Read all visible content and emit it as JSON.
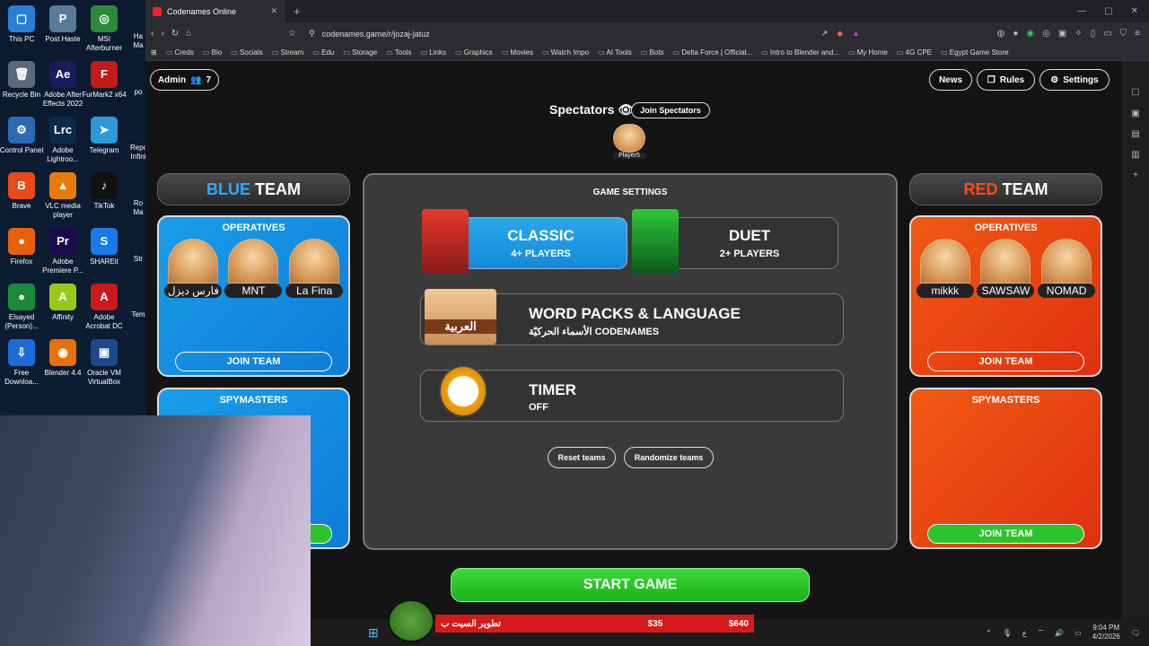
{
  "desktop": {
    "icons": [
      {
        "label": "This PC",
        "col": 0,
        "row": 0,
        "color": "#2a7fd4",
        "glyph": "▢"
      },
      {
        "label": "Post Haste",
        "col": 1,
        "row": 0,
        "color": "#5a7a9a",
        "glyph": "P"
      },
      {
        "label": "MSI Afterburner",
        "col": 2,
        "row": 0,
        "color": "#2a8a3a",
        "glyph": "◎"
      },
      {
        "label": "Recycle Bin",
        "col": 0,
        "row": 1,
        "color": "#5a6a7a",
        "glyph": "🗑"
      },
      {
        "label": "Adobe After Effects 2022",
        "col": 1,
        "row": 1,
        "color": "#1a1a5a",
        "glyph": "Ae"
      },
      {
        "label": "FurMark2 x64",
        "col": 2,
        "row": 1,
        "color": "#c41a1a",
        "glyph": "F"
      },
      {
        "label": "Control Panel",
        "col": 0,
        "row": 2,
        "color": "#2a6ab4",
        "glyph": "⚙"
      },
      {
        "label": "Adobe Lightroo...",
        "col": 1,
        "row": 2,
        "color": "#0a2a4a",
        "glyph": "Lrc"
      },
      {
        "label": "Telegram",
        "col": 2,
        "row": 2,
        "color": "#2a9ad8",
        "glyph": "➤"
      },
      {
        "label": "Brave",
        "col": 0,
        "row": 3,
        "color": "#e84a1a",
        "glyph": "B"
      },
      {
        "label": "VLC media player",
        "col": 1,
        "row": 3,
        "color": "#e87a0a",
        "glyph": "▲"
      },
      {
        "label": "TikTok",
        "col": 2,
        "row": 3,
        "color": "#111",
        "glyph": "♪"
      },
      {
        "label": "Firefox",
        "col": 0,
        "row": 4,
        "color": "#e8600a",
        "glyph": "●"
      },
      {
        "label": "Adobe Premiere P...",
        "col": 1,
        "row": 4,
        "color": "#1a0a4a",
        "glyph": "Pr"
      },
      {
        "label": "SHAREit",
        "col": 2,
        "row": 4,
        "color": "#1a7ae8",
        "glyph": "S"
      },
      {
        "label": "Elsayed (Person)...",
        "col": 0,
        "row": 5,
        "color": "#1a8a3a",
        "glyph": "●"
      },
      {
        "label": "Affinity",
        "col": 1,
        "row": 5,
        "color": "#9ac81a",
        "glyph": "A"
      },
      {
        "label": "Adobe Acrobat DC",
        "col": 2,
        "row": 5,
        "color": "#c81a1a",
        "glyph": "A"
      },
      {
        "label": "Free Downloa...",
        "col": 0,
        "row": 6,
        "color": "#1a6ad8",
        "glyph": "⇩"
      },
      {
        "label": "Blender 4.4",
        "col": 1,
        "row": 6,
        "color": "#e8700a",
        "glyph": "◉"
      },
      {
        "label": "Oracle VM VirtualBox",
        "col": 2,
        "row": 6,
        "color": "#1a4a8a",
        "glyph": "▣"
      }
    ],
    "partial_labels": [
      "Ha Ma",
      "po",
      "Repo Infini",
      "Ro Ma",
      "Str",
      "Tem"
    ]
  },
  "browser": {
    "tab_title": "Codenames Online",
    "url": "codenames.game/r/jozaj-jatuz",
    "bookmarks": [
      "Creds",
      "Bio",
      "Socials",
      "Stream",
      "Edu",
      "Storage",
      "Tools",
      "Links",
      "Graphics",
      "Movies",
      "Watch Impo",
      "AI Tools",
      "Bots",
      "Delta Force | Official...",
      "Intro to Blender and...",
      "My Home",
      "4G CPE",
      "Egypt Game Store"
    ]
  },
  "game": {
    "admin_label": "Admin",
    "player_count": "7",
    "news_label": "News",
    "rules_label": "Rules",
    "settings_label": "Settings",
    "spectators_label": "Spectators",
    "join_spectators_label": "Join Spectators",
    "spectator_name": "Player5",
    "blue_team": {
      "title_colored": "BLUE",
      "title_rest": "TEAM",
      "operatives_label": "OPERATIVES",
      "operatives": [
        "فارس ديزل",
        "MNT",
        "La Fina"
      ],
      "join_label": "JOIN TEAM",
      "spymasters_label": "SPYMASTERS"
    },
    "red_team": {
      "title_colored": "RED",
      "title_rest": "TEAM",
      "operatives_label": "OPERATIVES",
      "operatives": [
        "mikkk",
        "SAWSAW",
        "NOMAD"
      ],
      "join_label": "JOIN TEAM",
      "spymasters_label": "SPYMASTERS",
      "spymasters_join_label": "JOIN TEAM"
    },
    "settings_panel": {
      "title": "GAME SETTINGS",
      "classic_title": "CLASSIC",
      "classic_sub": "4+ PLAYERS",
      "duet_title": "DUET",
      "duet_sub": "2+ PLAYERS",
      "wordpack_title": "WORD PACKS & LANGUAGE",
      "wordpack_sub": "الأسماء الحركيّة CODENAMES",
      "wordpack_box_label": "العربية",
      "timer_title": "TIMER",
      "timer_sub": "OFF",
      "reset_label": "Reset teams",
      "randomize_label": "Randomize teams"
    },
    "start_label": "START GAME"
  },
  "overlay": {
    "text": "تطوير السيت ب",
    "amount_left": "$35",
    "amount_right": "$640"
  },
  "taskbar": {
    "lang": "ع",
    "time": "9:04 PM",
    "date": "4/2/2026"
  },
  "colors": {
    "blue_team": "#1a9ee8",
    "red_team": "#f05a14",
    "start_green": "#2cc42a"
  }
}
